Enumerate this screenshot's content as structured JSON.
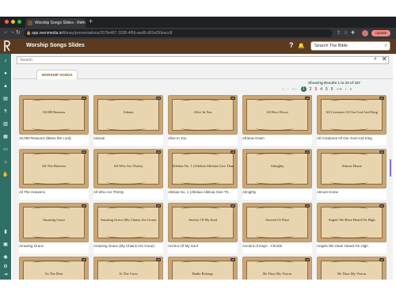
{
  "browser": {
    "tab_title": "Worship Songs Slides - Rem",
    "url_host": "app.reenmedia.io",
    "url_path": "/library/presentations/267fe467-1038-4f96-aed9-d01ef30eacc8",
    "update_label": "Update"
  },
  "app": {
    "title": "Worship Songs Slides",
    "bible_search_placeholder": "Search The Bible",
    "search_placeholder": "Search",
    "tab_label": "WORSHIP SONGS",
    "results_text": "Showing Results 1 to 20 of 197",
    "pages": [
      "1",
      "2",
      "3",
      "4",
      "5",
      "6"
    ],
    "current_page": "1"
  },
  "colors": {
    "header": "#5b3a1f",
    "sidebar": "#2f6f66",
    "accent": "#2f6f66"
  },
  "sidebar_icons": [
    "music-icon",
    "users-icon",
    "mountain-icon",
    "book-icon",
    "cross-icon",
    "book-open-icon",
    "bible-icon",
    "document-icon",
    "church-icon",
    "hands-icon",
    "chart-icon",
    "calendar-icon",
    "globe-icon",
    "settings-icon",
    "logout-icon"
  ],
  "songs": [
    {
      "thumb_title": "10,000 Reasons",
      "caption": "10,000 Reasons (Bless the Lord)",
      "badge": "HD"
    },
    {
      "thumb_title": "Adonai",
      "caption": "Adonai",
      "badge": "HD"
    },
    {
      "thumb_title": "Alive In You",
      "caption": "Alive In You",
      "badge": "HD"
    },
    {
      "thumb_title": "All Bow Down",
      "caption": "All Bow Down",
      "badge": "HD"
    },
    {
      "thumb_title": "All Creatures Of Our God And King",
      "caption": "All Creatures Of Our God And King",
      "badge": "HD"
    },
    {
      "thumb_title": "All The Heavens",
      "caption": "All The Heavens",
      "badge": "HD"
    },
    {
      "thumb_title": "All Who Are Thirsty",
      "caption": "All Who Are Thirsty",
      "badge": "HD"
    },
    {
      "thumb_title": "Alleluia No. 1 (Alleluia Alleluia Give Thanks)",
      "caption": "Alleluia No. 1 (Alleluia Alleluia Give Th...",
      "badge": "HD"
    },
    {
      "thumb_title": "Almighty",
      "caption": "Almighty",
      "badge": "HD"
    },
    {
      "thumb_title": "Almost Home",
      "caption": "Almost Home",
      "badge": "HD"
    },
    {
      "thumb_title": "Amazing Grace",
      "caption": "Amazing Grace",
      "badge": "HD"
    },
    {
      "thumb_title": "Amazing Grace (My Chains Are Gone)",
      "caption": "Amazing Grace (My Chains Are Gone)",
      "badge": "HD"
    },
    {
      "thumb_title": "Anchor Of My Soul",
      "caption": "Anchor Of My Soul",
      "badge": "HD"
    },
    {
      "thumb_title": "Ancient Of Days",
      "caption": "Ancient of Days - Chords",
      "badge": "HD"
    },
    {
      "thumb_title": "Angels We Have Heard On High",
      "caption": "Angels We Have Heard On High",
      "badge": "HD"
    },
    {
      "thumb_title": "As The Deer",
      "caption": "",
      "badge": "HD"
    },
    {
      "thumb_title": "At The Cross",
      "caption": "",
      "badge": "HD"
    },
    {
      "thumb_title": "Battle Belongs",
      "caption": "",
      "badge": "HD"
    },
    {
      "thumb_title": "Be Thou My Vision",
      "caption": "",
      "badge": "HD"
    },
    {
      "thumb_title": "Be Thou My Vision",
      "caption": "",
      "badge": "HD"
    }
  ]
}
